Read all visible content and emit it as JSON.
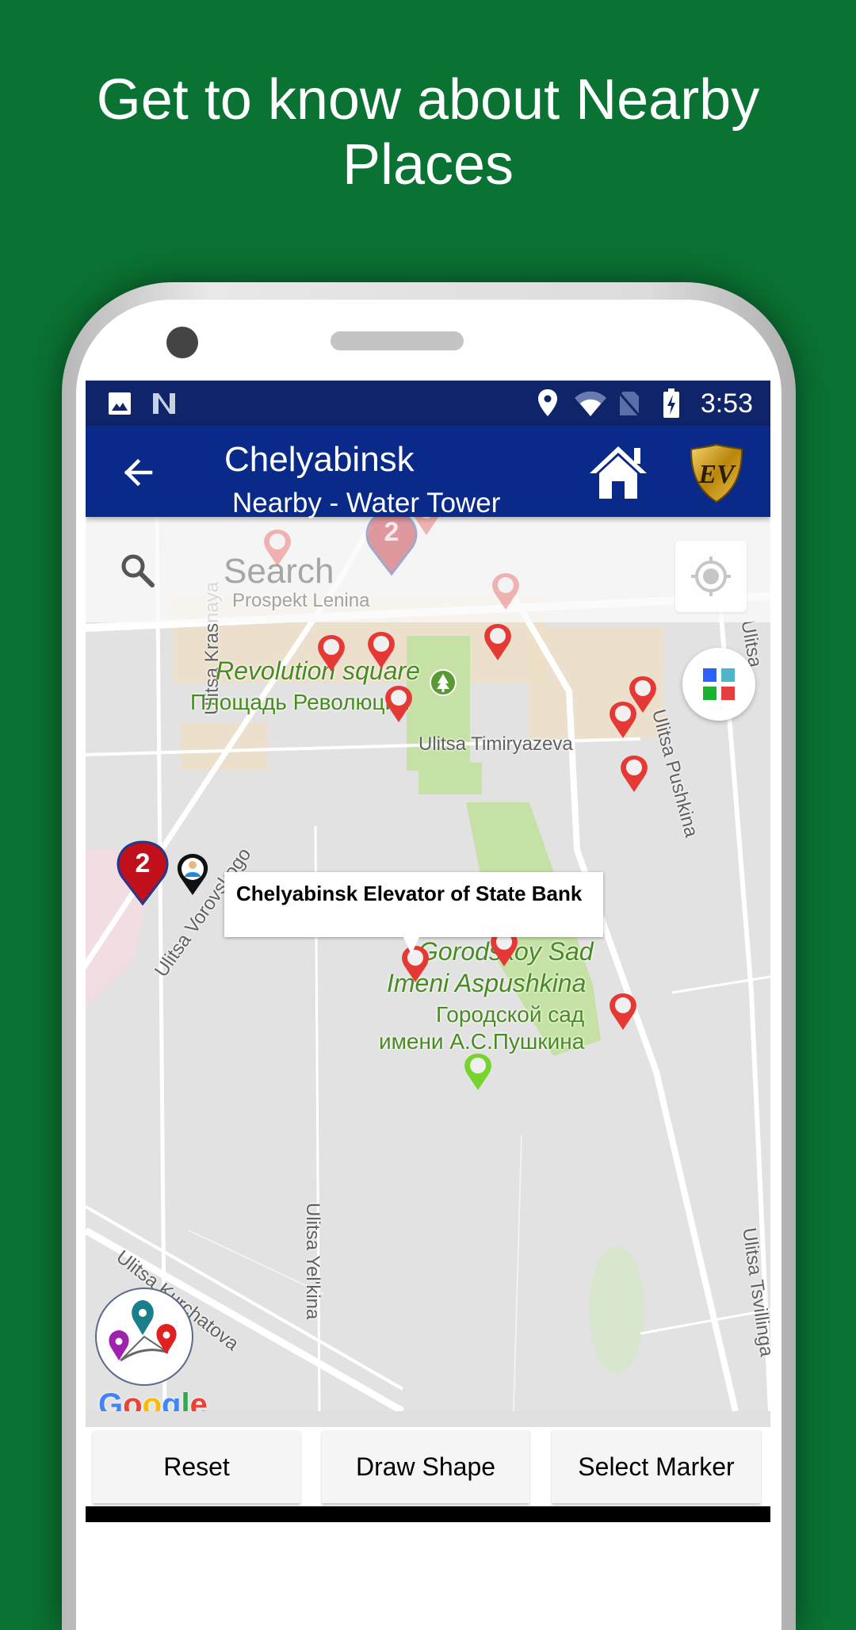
{
  "promo": {
    "headline_line1": "Get to know about Nearby",
    "headline_line2": "Places"
  },
  "status_bar": {
    "left_icons": [
      "image-icon",
      "n-notification-icon"
    ],
    "right_icons": [
      "location-icon",
      "wifi-icon",
      "no-sim-icon",
      "battery-charging-icon"
    ],
    "time": "3:53"
  },
  "app_bar": {
    "back_icon": "arrow-left-icon",
    "title": "Chelyabinsk",
    "subtitle": "Nearby - Water Tower",
    "home_icon": "home-icon",
    "logo_text": "EV"
  },
  "search": {
    "placeholder": "Search",
    "icon": "search-icon"
  },
  "map": {
    "street_labels": {
      "prospekt_lenina": "Prospekt Lenina",
      "krasnaya": "Ulitsa Krasnaya",
      "vorovskogo": "Ulitsa Vorovskogo",
      "timiryazeva": "Ulitsa Timiryazeva",
      "pushkina": "Ulitsa Pushkina",
      "yelkina": "Ulitsa Yel'kina",
      "kurchatova": "Ulitsa Kurchatova",
      "tsvillinga": "Ulitsa Tsvillinga",
      "ulitsa_top_right": "Ulitsa"
    },
    "place_labels": {
      "revolution_square_en": "Revolution square",
      "revolution_square_ru": "Площадь Революции",
      "gorodskoy_sad_en_1": "Gorodskoy Sad",
      "gorodskoy_sad_en_2": "Imeni Aspushkina",
      "gorodskoy_sad_ru_1": "Городской сад",
      "gorodskoy_sad_ru_2": "имени А.С.Пушкина"
    },
    "clusters": [
      {
        "count": "2",
        "faded": true
      },
      {
        "count": "2",
        "faded": false
      }
    ],
    "info_window": {
      "title": "Chelyabinsk Elevator of State Bank"
    },
    "attribution": "Google",
    "colors": {
      "pin_red": "#e53935",
      "pin_green": "#76d42a",
      "cluster_red": "#c0101c",
      "park_green": "#c5e1a5"
    }
  },
  "buttons": {
    "reset": "Reset",
    "draw_shape": "Draw Shape",
    "select_marker": "Select Marker"
  }
}
